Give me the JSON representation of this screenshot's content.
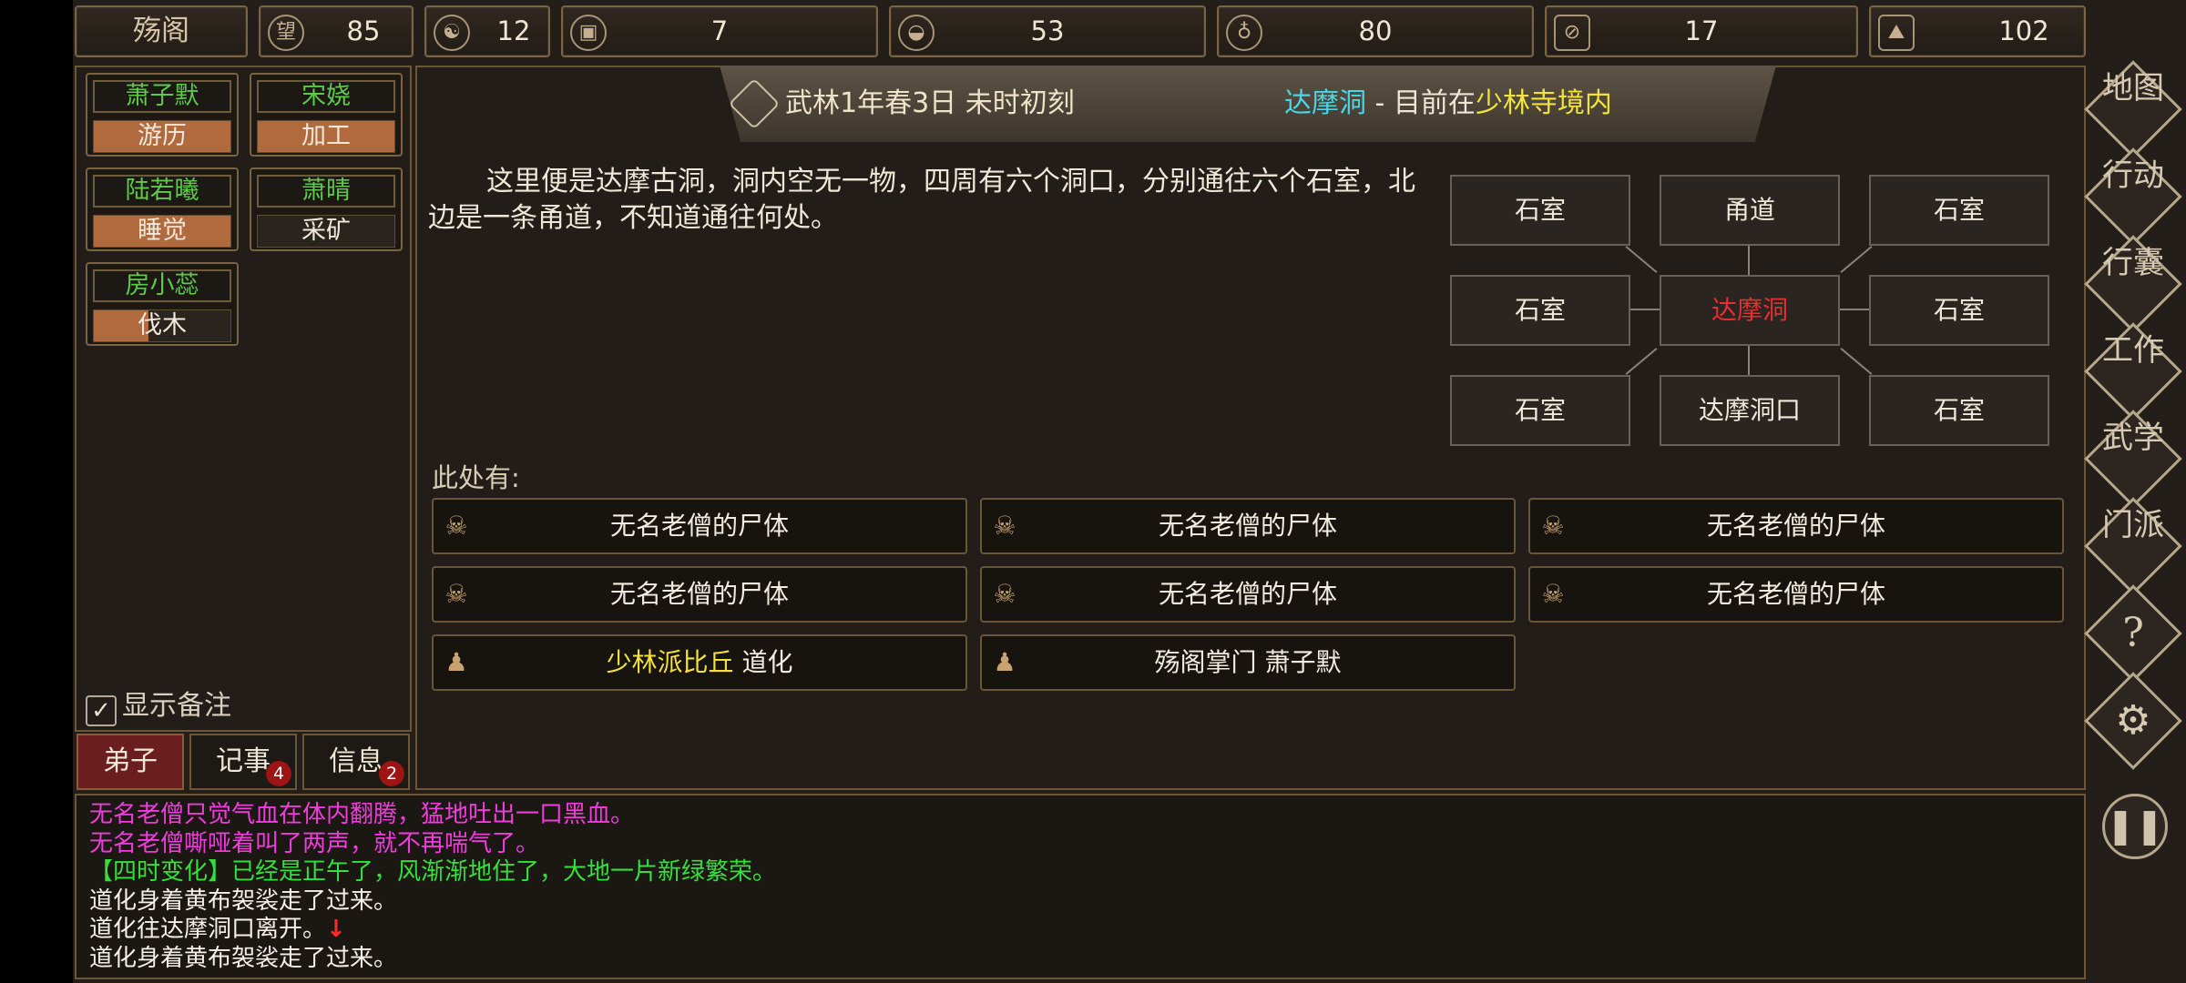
{
  "topbar": {
    "sect_name": "殇阁",
    "resources": [
      {
        "icon": "reputation-icon",
        "value": "85"
      },
      {
        "icon": "yin-yang-icon",
        "value": "12"
      },
      {
        "icon": "coin-icon",
        "value": "7"
      },
      {
        "icon": "food-bowl-icon",
        "value": "53"
      },
      {
        "icon": "gourd-icon",
        "value": "80"
      },
      {
        "icon": "wood-log-icon",
        "value": "17"
      },
      {
        "icon": "ore-icon",
        "value": "102"
      }
    ]
  },
  "disciples": [
    {
      "name": "萧子默",
      "task": "游历",
      "progress": 1.0
    },
    {
      "name": "宋娆",
      "task": "加工",
      "progress": 1.0
    },
    {
      "name": "陆若曦",
      "task": "睡觉",
      "progress": 1.0
    },
    {
      "name": "萧晴",
      "task": "采矿",
      "progress": 0.0
    },
    {
      "name": "房小蕊",
      "task": "伐木",
      "progress": 0.4
    }
  ],
  "left": {
    "show_notes": "显示备注",
    "tabs": [
      {
        "label": "弟子",
        "badge": ""
      },
      {
        "label": "记事",
        "badge": "4"
      },
      {
        "label": "信息",
        "badge": "2"
      }
    ]
  },
  "banner": {
    "date": "武林1年春3日 未时初刻",
    "location": "达摩洞",
    "separator": " - ",
    "prefix": "目前在",
    "region": "少林寺境内"
  },
  "description": "这里便是达摩古洞，洞内空无一物，四周有六个洞口，分别通往六个石室，北边是一条甬道，不知道通往何处。",
  "map": {
    "nw": "石室",
    "n": "甬道",
    "ne": "石室",
    "w": "石室",
    "center": "达摩洞",
    "e": "石室",
    "sw": "石室",
    "s": "达摩洞口",
    "se": "石室"
  },
  "here": {
    "label": "此处有:",
    "objects": [
      {
        "icon": "skull-icon",
        "text": "无名老僧的尸体"
      },
      {
        "icon": "skull-icon",
        "text": "无名老僧的尸体"
      },
      {
        "icon": "skull-icon",
        "text": "无名老僧的尸体"
      },
      {
        "icon": "skull-icon",
        "text": "无名老僧的尸体"
      },
      {
        "icon": "skull-icon",
        "text": "无名老僧的尸体"
      },
      {
        "icon": "skull-icon",
        "text": "无名老僧的尸体"
      }
    ],
    "npcs": [
      {
        "icon": "person-icon",
        "title": "少林派比丘",
        "name": " 道化"
      },
      {
        "icon": "person-icon",
        "title": "殇阁掌门",
        "name": " 萧子默"
      }
    ]
  },
  "right_menu": {
    "items": [
      "地图",
      "行动",
      "行囊",
      "工作",
      "武学",
      "门派"
    ],
    "help": "?",
    "settings_icon": "gear-icon",
    "pause_icon": "pause-icon"
  },
  "log": [
    "无名老僧只觉气血在体内翻腾，猛地吐出一口黑血。",
    "无名老僧嘶哑着叫了两声，就不再喘气了。",
    "【四时变化】已经是正午了，风渐渐地住了，大地一片新绿繁荣。",
    "道化身着黄布袈裟走了过来。",
    "道化往达摩洞口离开。",
    "道化身着黄布袈裟走了过来。"
  ],
  "log_arrow": "↓",
  "colors": {
    "accent_gold": "#7a6443",
    "disciple_name": "#5ec94a",
    "task_fill": "#b06a3e",
    "current_room": "#e23030",
    "location_cyan": "#4ad6e6",
    "region_yellow": "#f2e23a",
    "log_magenta": "#f03cdc",
    "log_green": "#34e03c"
  }
}
